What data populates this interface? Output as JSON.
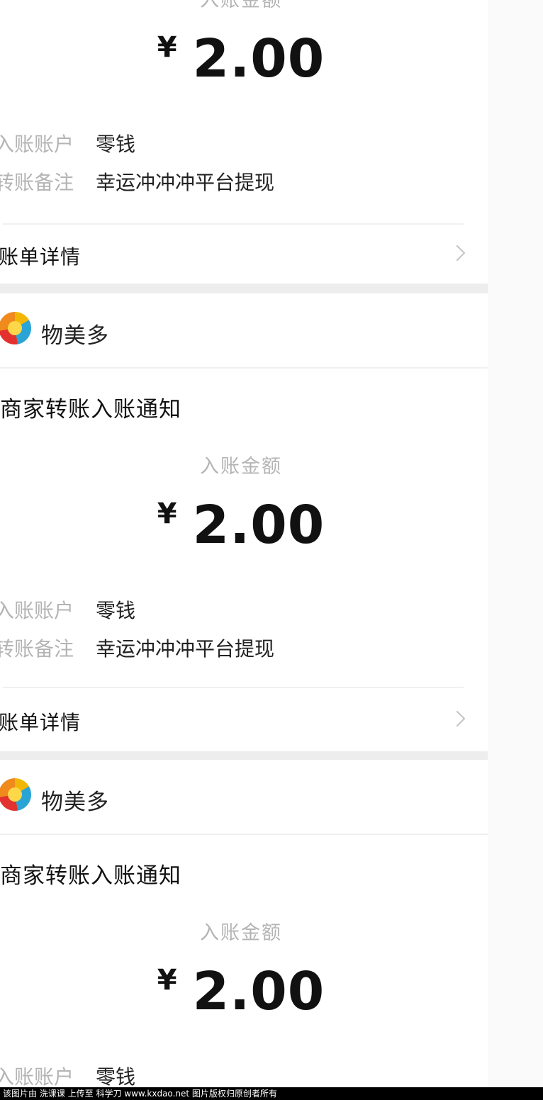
{
  "cards": [
    {
      "merchant": "",
      "title": "",
      "amount_label": "入账金额",
      "currency_symbol": "¥",
      "amount": "2.00",
      "account_label": "入账账户",
      "account_value": "零钱",
      "note_label": "转账备注",
      "note_value": "幸运冲冲冲平台提现",
      "detail_label": "账单详情"
    },
    {
      "merchant": "物美多",
      "title": "商家转账入账通知",
      "amount_label": "入账金额",
      "currency_symbol": "¥",
      "amount": "2.00",
      "account_label": "入账账户",
      "account_value": "零钱",
      "note_label": "转账备注",
      "note_value": "幸运冲冲冲平台提现",
      "detail_label": "账单详情"
    },
    {
      "merchant": "物美多",
      "title": "商家转账入账通知",
      "amount_label": "入账金额",
      "currency_symbol": "¥",
      "amount": "2.00",
      "account_label": "入账账户",
      "account_value": "零钱"
    }
  ],
  "footer": {
    "text": "该图片由 洗课课 上传至 科学刀 www.kxdao.net 图片版权归原创者所有"
  },
  "colors": {
    "page_bg": "#ededed",
    "card_bg": "#ffffff",
    "muted_text": "#b4b4b4",
    "primary_text": "#111111"
  }
}
